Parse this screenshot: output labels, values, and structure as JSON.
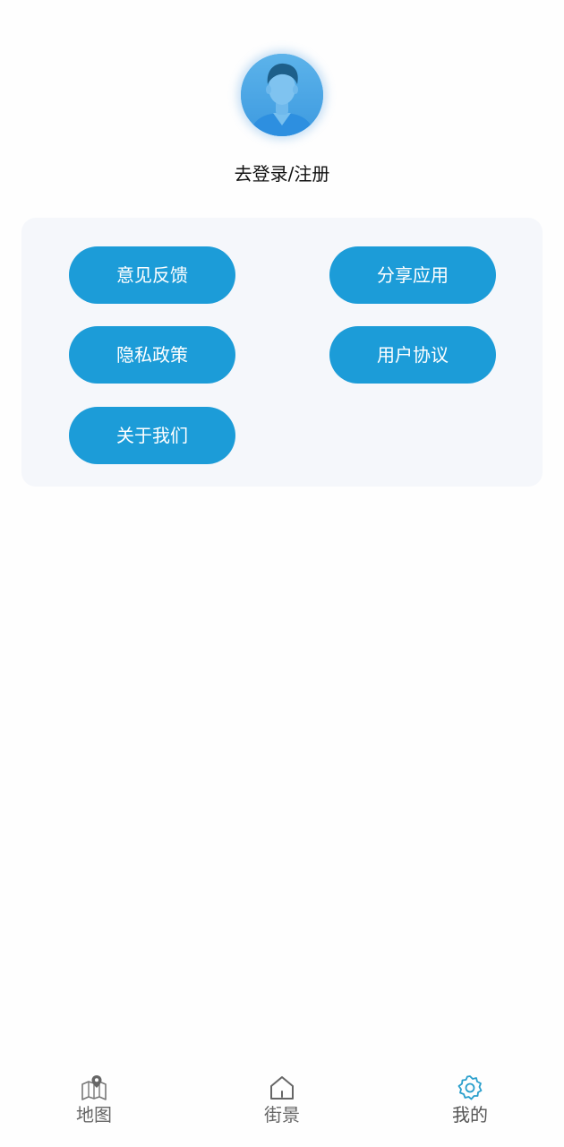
{
  "profile": {
    "login_label": "去登录/注册",
    "avatar_icon": "user-avatar-icon"
  },
  "menu": {
    "feedback": "意见反馈",
    "share": "分享应用",
    "privacy": "隐私政策",
    "agreement": "用户协议",
    "about": "关于我们"
  },
  "tabbar": {
    "tabs": [
      {
        "label": "地图",
        "icon": "map-pin-icon",
        "active": false
      },
      {
        "label": "街景",
        "icon": "home-icon",
        "active": false
      },
      {
        "label": "我的",
        "icon": "gear-icon",
        "active": true
      }
    ]
  },
  "colors": {
    "accent": "#1c9cd8",
    "card_bg": "#f5f7fb",
    "active_icon": "#2a9fcc",
    "inactive": "#666666"
  }
}
